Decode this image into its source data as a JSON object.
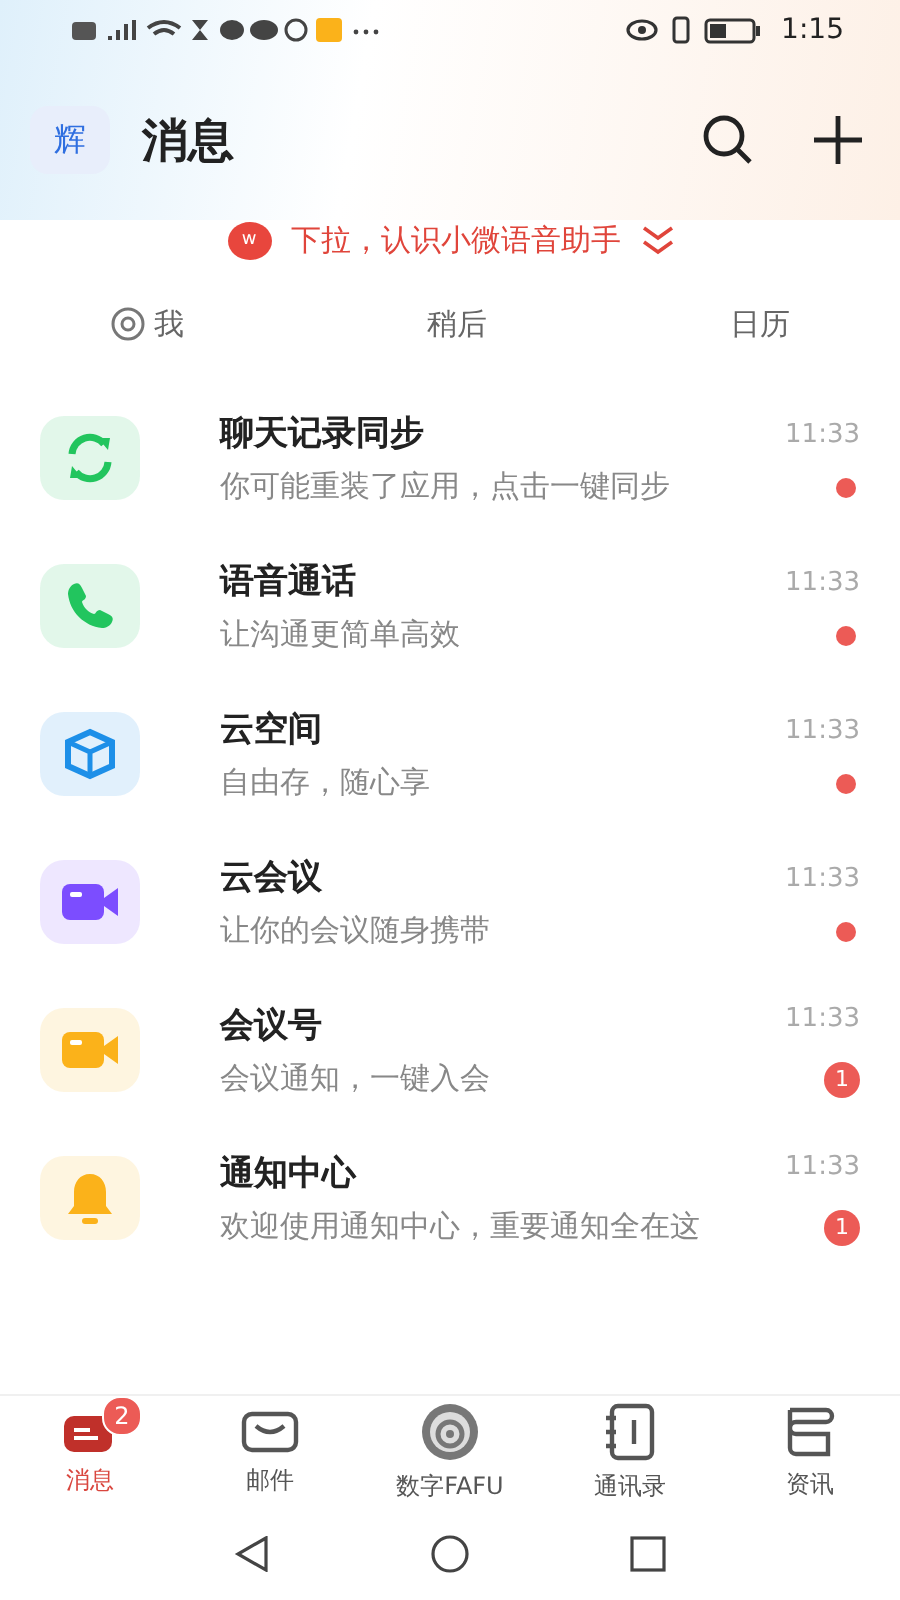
{
  "status_bar": {
    "time": "1:15"
  },
  "header": {
    "avatar": "辉",
    "title": "消息"
  },
  "banner": {
    "logo": "w",
    "text": "下拉，认识小微语音助手"
  },
  "filters": [
    {
      "label": "我",
      "kind": "mention"
    },
    {
      "label": "稍后",
      "kind": "plain"
    },
    {
      "label": "日历",
      "kind": "plain"
    }
  ],
  "messages": [
    {
      "kind": "sync",
      "color": "#22c55e",
      "title": "聊天记录同步",
      "subtitle": "你可能重装了应用，点击一键同步",
      "time": "11:33",
      "badge": {
        "kind": "dot"
      }
    },
    {
      "kind": "phone",
      "color": "#22c55e",
      "title": "语音通话",
      "subtitle": "让沟通更简单高效",
      "time": "11:33",
      "badge": {
        "kind": "dot"
      }
    },
    {
      "kind": "cube",
      "color": "#1d8fe8",
      "title": "云空间",
      "subtitle": "自由存，随心享",
      "time": "11:33",
      "badge": {
        "kind": "dot"
      }
    },
    {
      "kind": "video",
      "color": "#7c4dff",
      "title": "云会议",
      "subtitle": "让你的会议随身携带",
      "time": "11:33",
      "badge": {
        "kind": "dot"
      }
    },
    {
      "kind": "video",
      "color": "#fbb21a",
      "title": "会议号",
      "subtitle": "会议通知，一键入会",
      "time": "11:33",
      "badge": {
        "kind": "count",
        "text": "1"
      }
    },
    {
      "kind": "bell",
      "color": "#fbb21a",
      "title": "通知中心",
      "subtitle": "欢迎使用通知中心，重要通知全在这",
      "time": "11:33",
      "badge": {
        "kind": "count",
        "text": "1"
      }
    }
  ],
  "nav": [
    {
      "kind": "chat",
      "label": "消息",
      "selected": true,
      "badge": "2"
    },
    {
      "kind": "mail",
      "label": "邮件",
      "selected": false
    },
    {
      "kind": "seal",
      "label": "数字FAFU",
      "selected": false
    },
    {
      "kind": "book",
      "label": "通讯录",
      "selected": false
    },
    {
      "kind": "news",
      "label": "资讯",
      "selected": false
    }
  ]
}
